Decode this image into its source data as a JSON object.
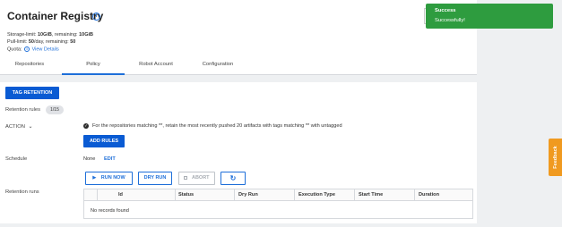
{
  "page": {
    "title": "Container Registry",
    "storage": {
      "label": "Storage-limit:",
      "limit": "10GiB",
      "sep": ", remaining:",
      "remaining": "10GiB"
    },
    "pull": {
      "label": "Pull-limit:",
      "limit": "50",
      "sep": "/day, remaining:",
      "remaining": "50"
    },
    "quota": {
      "label": "Quota:",
      "link": "View Details"
    }
  },
  "tabs": [
    {
      "label": "Repositories",
      "active": false
    },
    {
      "label": "Policy",
      "active": true
    },
    {
      "label": "Robot Account",
      "active": false
    },
    {
      "label": "Configuration",
      "active": false
    }
  ],
  "policy": {
    "tag_retention_button": "TAG RETENTION",
    "retention_rules_label": "Retention rules",
    "retention_rules_count": "1/15",
    "action_label": "ACTION",
    "rule_text": "For the repositories matching **, retain the most recently pushed 20 artifacts with tags matching ** with untagged",
    "add_rules_button": "ADD RULES",
    "schedule_label": "Schedule",
    "schedule_value": "None",
    "schedule_edit": "EDIT",
    "run_now_button": "RUN NOW",
    "dry_run_button": "DRY RUN",
    "abort_button": "ABORT",
    "retention_runs_label": "Retention runs",
    "columns": [
      "Id",
      "Status",
      "Dry Run",
      "Execution Type",
      "Start Time",
      "Duration"
    ],
    "empty_text": "No records found"
  },
  "toast": {
    "title": "Success",
    "message": "Successfully!"
  },
  "feedback": "Feedback",
  "colors": {
    "primary": "#0a5bd3",
    "success": "#2e9c3f",
    "feedback": "#f09a20"
  }
}
